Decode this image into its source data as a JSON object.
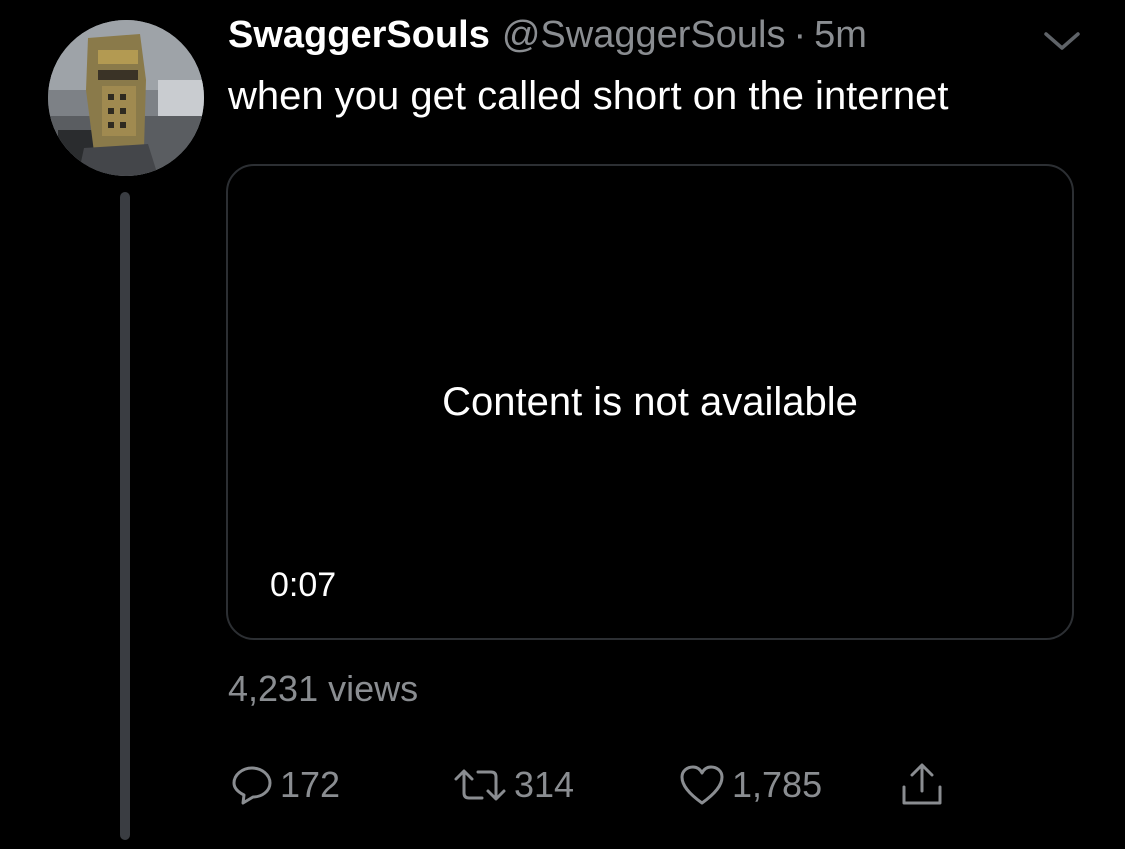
{
  "author": {
    "display_name": "SwaggerSouls",
    "handle": "@SwaggerSouls",
    "separator": "·",
    "time": "5m"
  },
  "tweet": {
    "text": "when you get called short on the internet"
  },
  "media": {
    "message": "Content is not available",
    "duration": "0:07"
  },
  "stats": {
    "views": "4,231 views",
    "replies": "172",
    "retweets": "314",
    "likes": "1,785"
  },
  "icons": {
    "menu": "chevron-down-icon",
    "reply": "reply-icon",
    "retweet": "retweet-icon",
    "like": "heart-icon",
    "share": "share-icon"
  },
  "colors": {
    "background": "#000000",
    "primary_text": "#ffffff",
    "secondary_text": "#8a8d91",
    "border": "#2c2f33",
    "thread_line": "#3a3d42"
  }
}
